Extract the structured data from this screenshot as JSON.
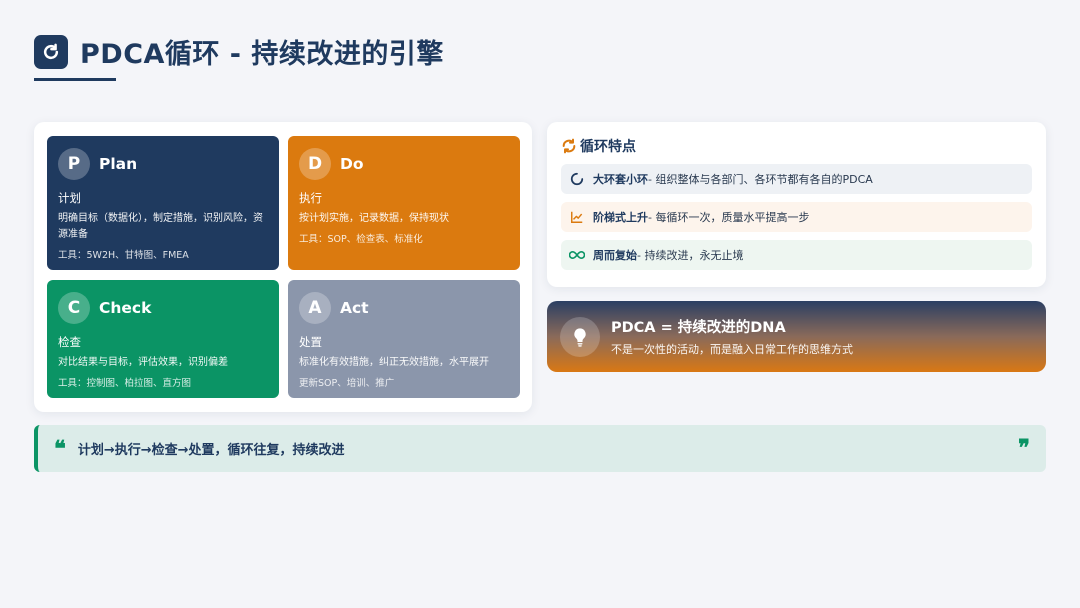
{
  "header": {
    "title": "PDCA循环 - 持续改进的引擎",
    "logo_icon": "refresh-icon"
  },
  "cards": {
    "plan": {
      "letter": "P",
      "name": "Plan",
      "sub": "计划",
      "desc": "明确目标（数据化），制定措施，识别风险，资源准备",
      "tools": "工具：5W2H、甘特图、FMEA",
      "color": "#1f3a5f"
    },
    "do": {
      "letter": "D",
      "name": "Do",
      "sub": "执行",
      "desc": "按计划实施，记录数据，保持现状",
      "tools": "工具：SOP、检查表、标准化",
      "color": "#db7a0f"
    },
    "check": {
      "letter": "C",
      "name": "Check",
      "sub": "检查",
      "desc": "对比结果与目标，评估效果，识别偏差",
      "tools": "工具：控制图、柏拉图、直方图",
      "color": "#0b9465"
    },
    "act": {
      "letter": "A",
      "name": "Act",
      "sub": "处置",
      "desc": "标准化有效措施，纠正无效措施，水平展开",
      "tools": "更新SOP、培训、推广",
      "color": "#8b96ab"
    }
  },
  "features": {
    "title": "循环特点",
    "title_icon": "sync-icon",
    "items": [
      {
        "icon": "circle-notch-icon",
        "bold": "大环套小环",
        "text": " - 组织整体与各部门、各环节都有各自的PDCA"
      },
      {
        "icon": "chart-line-icon",
        "bold": "阶梯式上升",
        "text": " - 每循环一次，质量水平提高一步"
      },
      {
        "icon": "infinity-icon",
        "bold": "周而复始",
        "text": " - 持续改进，永无止境"
      }
    ]
  },
  "dna": {
    "title": "PDCA = 持续改进的DNA",
    "subtitle": "不是一次性的活动，而是融入日常工作的思维方式",
    "icon": "lightbulb-icon"
  },
  "quote": {
    "text": "计划→执行→检查→处置，循环往复，持续改进",
    "open_mark": "❝",
    "close_mark": "❞"
  }
}
